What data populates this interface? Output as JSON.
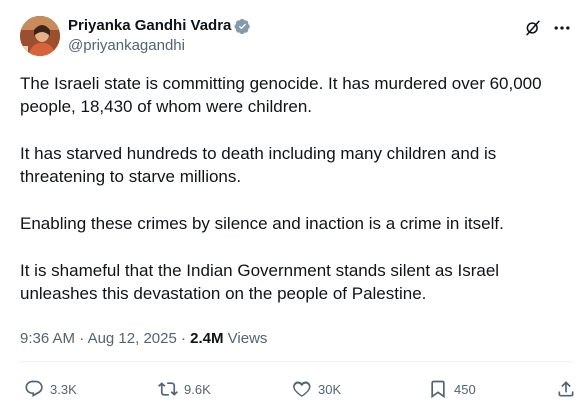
{
  "author": {
    "display_name": "Priyanka Gandhi Vadra",
    "handle": "@priyankagandhi"
  },
  "icons": {
    "verified": "verified-badge-icon",
    "grok": "grok-icon",
    "more": "more-options-icon",
    "reply": "reply-icon",
    "retweet": "retweet-icon",
    "like": "like-icon",
    "bookmark": "bookmark-icon",
    "share": "share-icon"
  },
  "colors": {
    "verified": "#1d9bf0",
    "text": "#0f1419",
    "secondary": "#536471"
  },
  "post": {
    "paragraphs": [
      "The Israeli state is committing  genocide. It has murdered over 60,000 people, 18,430 of whom were children.",
      "It has starved hundreds to death including many children and is threatening to starve millions.",
      "Enabling these crimes by silence and inaction is a crime in itself.",
      "It is shameful that the Indian Government stands silent as Israel unleashes this devastation on the people of Palestine."
    ]
  },
  "meta": {
    "time": "9:36 AM",
    "separator_1": " · ",
    "date": "Aug 12, 2025",
    "separator_2": " · ",
    "views_count": "2.4M",
    "views_label": " Views"
  },
  "actions": {
    "replies": "3.3K",
    "reposts": "9.6K",
    "likes": "30K",
    "bookmarks": "450"
  }
}
